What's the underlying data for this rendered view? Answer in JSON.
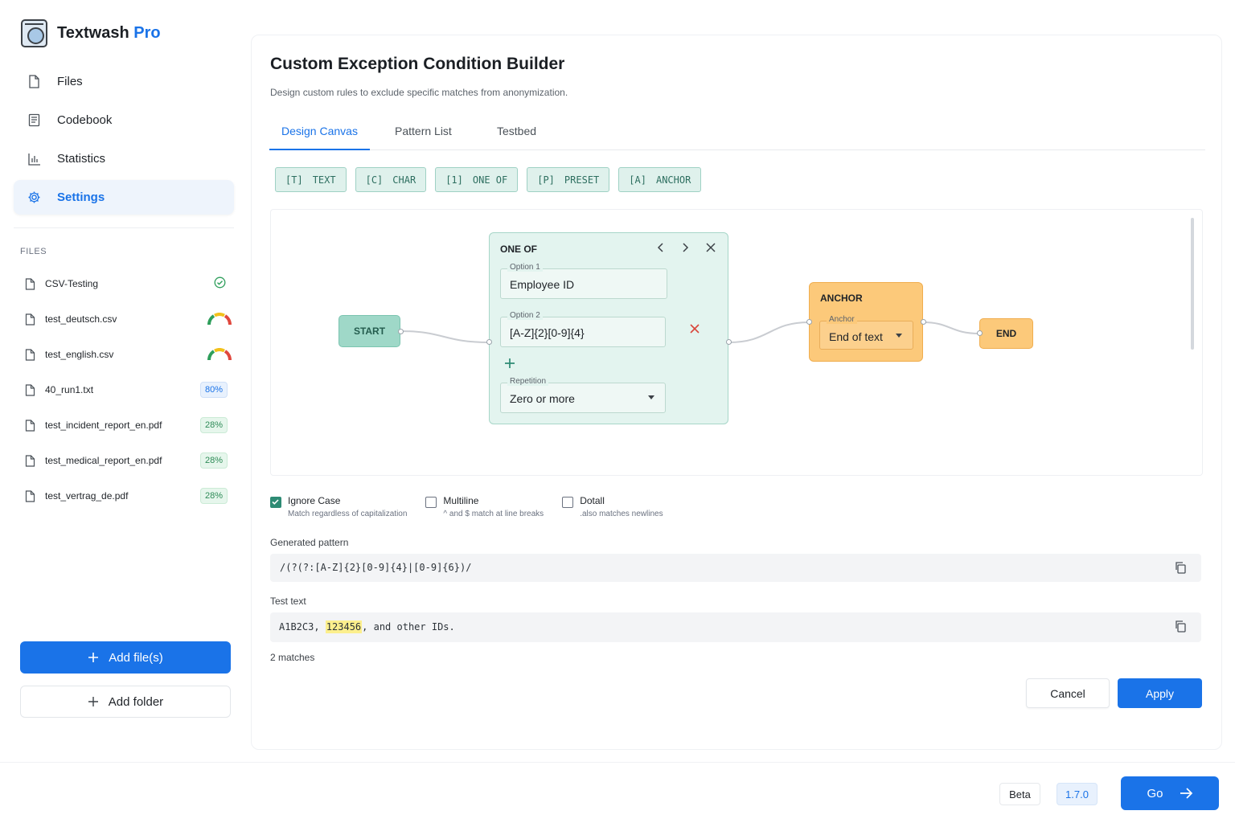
{
  "app": {
    "name": "Textwash",
    "name_suffix": "Pro"
  },
  "nav": [
    {
      "label": "Files",
      "icon": "file-icon"
    },
    {
      "label": "Codebook",
      "icon": "codebook-icon"
    },
    {
      "label": "Statistics",
      "icon": "bar-chart-icon"
    },
    {
      "label": "Settings",
      "icon": "gear-icon",
      "active": true
    }
  ],
  "files_section": {
    "heading": "FILES",
    "files": [
      {
        "name": "CSV-Testing",
        "status": "complete"
      },
      {
        "name": "test_deutsch.csv",
        "status": "gauge"
      },
      {
        "name": "test_english.csv",
        "status": "gauge"
      },
      {
        "name": "40_run1.txt",
        "progress": "80%"
      },
      {
        "name": "test_incident_report_en.pdf",
        "progress": "28%"
      },
      {
        "name": "test_medical_report_en.pdf",
        "progress": "28%"
      },
      {
        "name": "test_vertrag_de.pdf",
        "progress": "28%"
      }
    ],
    "add_files_label": "Add file(s)",
    "add_folder_label": "Add folder"
  },
  "builder": {
    "title": "Custom Exception Condition Builder",
    "subtitle": "Design custom rules to exclude specific matches from anonymization.",
    "tabs": [
      "Design Canvas",
      "Pattern List",
      "Testbed"
    ],
    "active_tab": "Design Canvas",
    "toolbar": [
      {
        "key": "[T]",
        "label": "TEXT"
      },
      {
        "key": "[C]",
        "label": "CHAR"
      },
      {
        "key": "[1]",
        "label": "ONE OF"
      },
      {
        "key": "[P]",
        "label": "PRESET"
      },
      {
        "key": "[A]",
        "label": "ANCHOR"
      }
    ],
    "nodes": {
      "start": "START",
      "one_of": {
        "title": "ONE OF",
        "option1_label": "Option 1",
        "option1_value": "Employee ID",
        "option2_label": "Option 2",
        "option2_value": "[A-Z]{2}[0-9]{4}",
        "repetition_label": "Repetition",
        "repetition_value": "Zero or more"
      },
      "anchor": {
        "title": "ANCHOR",
        "field_label": "Anchor",
        "field_value": "End of text"
      },
      "end": "END"
    },
    "options": [
      {
        "label": "Ignore Case",
        "desc": "Match regardless of capitalization",
        "checked": true
      },
      {
        "label": "Multiline",
        "desc": "^ and $ match at line breaks",
        "checked": false
      },
      {
        "label": "Dotall",
        "desc": ".also matches newlines",
        "checked": false
      }
    ],
    "generated_label": "Generated pattern",
    "generated_pattern": "/(?(?:[A-Z]{2}[0-9]{4}|[0-9]{6})/",
    "test_label": "Test text",
    "test_text_before": "A1B2C3, ",
    "test_text_match": "123456",
    "test_text_after": ", and other IDs.",
    "matches": "2 matches",
    "cancel_label": "Cancel",
    "apply_label": "Apply"
  },
  "footer": {
    "beta": "Beta",
    "version": "1.7.0",
    "go_label": "Go"
  },
  "colors": {
    "accent": "#1a73e8",
    "teal_node": "#9fd8c8",
    "orange_node": "#fcc97a",
    "highlight": "#fcef8d"
  }
}
